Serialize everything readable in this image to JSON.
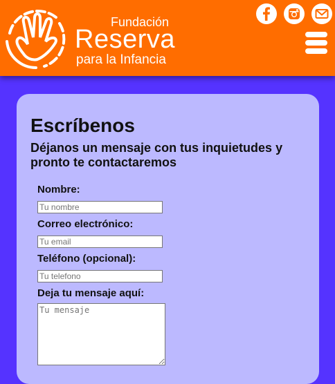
{
  "header": {
    "logo_line1": "Fundación",
    "logo_line2": "Reserva",
    "logo_line3": "para la Infancia",
    "social_icons": [
      "facebook-icon",
      "instagram-icon",
      "email-icon"
    ],
    "menu_icon": "hamburger-menu-icon"
  },
  "colors": {
    "header_bg": "#ff6d00",
    "page_bg": "#5533ff",
    "card_bg": "#bcb9ff",
    "icon_glyph": "#ff6d00"
  },
  "form": {
    "title": "Escríbenos",
    "subtitle": "Déjanos un mensaje con tus inquietudes y pronto te contactaremos",
    "name_label": "Nombre:",
    "name_placeholder": "Tu nombre",
    "email_label": "Correo electrónico:",
    "email_placeholder": "Tu email",
    "phone_label": "Teléfono (opcional):",
    "phone_placeholder": "Tu telefono",
    "message_label": "Deja tu mensaje aquí:",
    "message_placeholder": "Tu mensaje"
  }
}
